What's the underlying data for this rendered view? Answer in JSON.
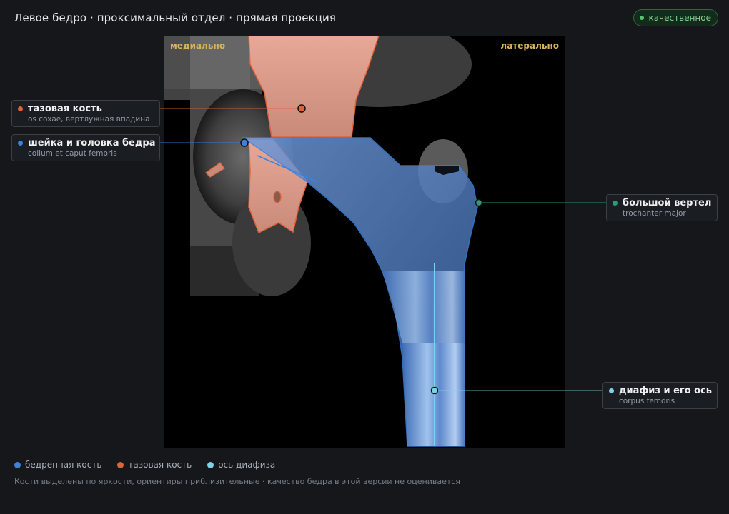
{
  "header": {
    "title": "Левое бедро · проксимальный отдел · прямая проекция",
    "quality_badge": "качественное"
  },
  "image": {
    "orientation_left": "медиально",
    "orientation_right": "латерально"
  },
  "annotations": [
    {
      "id": "pelvis",
      "name": "тазовая кость",
      "latin": "os coxae, вертлужная впадина",
      "color": "#e0623a"
    },
    {
      "id": "neck",
      "name": "шейка и головка бедра",
      "latin": "collum et caput femoris",
      "color": "#3b82e0"
    },
    {
      "id": "trochanter",
      "name": "большой вертел",
      "latin": "trochanter major",
      "color": "#2f9a73"
    },
    {
      "id": "shaft",
      "name": "диафиз и его ось",
      "latin": "corpus femoris",
      "color": "#7fd0ec"
    }
  ],
  "legend": [
    {
      "label": "бедренная кость",
      "color": "#3b82e0"
    },
    {
      "label": "тазовая кость",
      "color": "#e0623a"
    },
    {
      "label": "ось диафиза",
      "color": "#7fd0ec"
    }
  ],
  "footnote": "Кости выделены по яркости, ориентиры приблизительные · качество бедра в этой версии не оценивается"
}
